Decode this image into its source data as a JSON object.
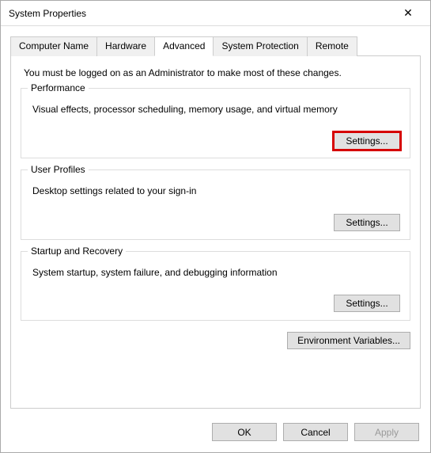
{
  "window": {
    "title": "System Properties"
  },
  "tabs": {
    "computer_name": "Computer Name",
    "hardware": "Hardware",
    "advanced": "Advanced",
    "system_protection": "System Protection",
    "remote": "Remote"
  },
  "admin_note": "You must be logged on as an Administrator to make most of these changes.",
  "groups": {
    "performance": {
      "legend": "Performance",
      "desc": "Visual effects, processor scheduling, memory usage, and virtual memory",
      "button": "Settings..."
    },
    "user_profiles": {
      "legend": "User Profiles",
      "desc": "Desktop settings related to your sign-in",
      "button": "Settings..."
    },
    "startup_recovery": {
      "legend": "Startup and Recovery",
      "desc": "System startup, system failure, and debugging information",
      "button": "Settings..."
    }
  },
  "env_button": "Environment Variables...",
  "footer": {
    "ok": "OK",
    "cancel": "Cancel",
    "apply": "Apply"
  }
}
